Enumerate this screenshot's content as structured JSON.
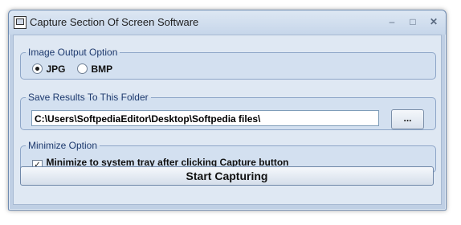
{
  "window": {
    "title": "Capture Section Of Screen Software"
  },
  "image_output": {
    "legend": "Image Output Option",
    "options": [
      {
        "label": "JPG",
        "selected": true
      },
      {
        "label": "BMP",
        "selected": false
      }
    ]
  },
  "save_folder": {
    "legend": "Save Results To This Folder",
    "path": "C:\\Users\\SoftpediaEditor\\Desktop\\Softpedia files\\",
    "browse_label": "..."
  },
  "minimize": {
    "legend": "Minimize Option",
    "checkbox_label": "Minimize to system tray after clicking Capture button",
    "checked": true
  },
  "start_button_label": "Start Capturing",
  "icons": [
    "app-icon",
    "minimize-icon",
    "maximize-icon",
    "close-icon",
    "checkmark-icon"
  ]
}
